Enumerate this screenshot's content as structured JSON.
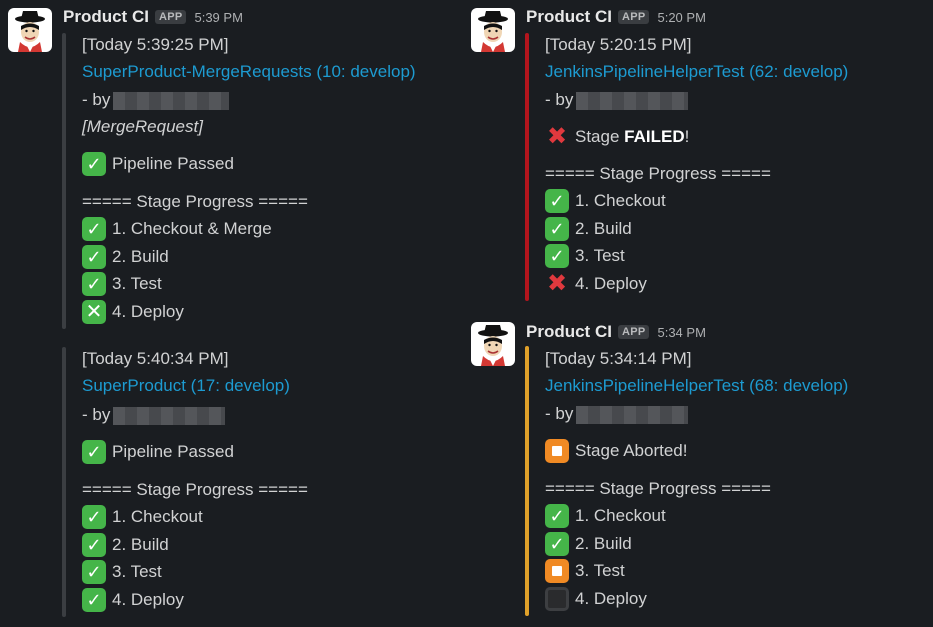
{
  "colors": {
    "background": "#1a1d21",
    "link": "#1d9bd1",
    "bar_neutral": "#3b3e42",
    "bar_failed": "#b3151d",
    "bar_aborted": "#e0a12a",
    "check_green": "#45b549"
  },
  "bot": {
    "name": "Product CI",
    "badge": "APP"
  },
  "messages": [
    {
      "time": "5:39 PM",
      "blocks": [
        {
          "timestamp": "[Today 5:39:25 PM]",
          "link": "SuperProduct-MergeRequests (10: develop)",
          "by": "- by",
          "tag": "[MergeRequest]",
          "status_icon": "check",
          "status": "Pipeline Passed",
          "progress_header": "===== Stage Progress =====",
          "stages": [
            {
              "icon": "check",
              "label": "1. Checkout & Merge"
            },
            {
              "icon": "check",
              "label": "2. Build"
            },
            {
              "icon": "check",
              "label": "3. Test"
            },
            {
              "icon": "x-green",
              "label": "4. Deploy"
            }
          ]
        },
        {
          "timestamp": "[Today 5:40:34 PM]",
          "link": "SuperProduct (17: develop)",
          "by": "- by",
          "status_icon": "check",
          "status": "Pipeline Passed",
          "progress_header": "===== Stage Progress =====",
          "stages": [
            {
              "icon": "check",
              "label": "1. Checkout"
            },
            {
              "icon": "check",
              "label": "2. Build"
            },
            {
              "icon": "check",
              "label": "3. Test"
            },
            {
              "icon": "check",
              "label": "4. Deploy"
            }
          ]
        }
      ]
    },
    {
      "time": "5:20 PM",
      "timestamp": "[Today 5:20:15 PM]",
      "link": "JenkinsPipelineHelperTest (62: develop)",
      "by": "- by",
      "status_icon": "cross",
      "status_prefix": "Stage ",
      "status_bold": "FAILED",
      "status_suffix": "!",
      "progress_header": "===== Stage Progress =====",
      "stages": [
        {
          "icon": "check",
          "label": "1. Checkout"
        },
        {
          "icon": "check",
          "label": "2. Build"
        },
        {
          "icon": "check",
          "label": "3. Test"
        },
        {
          "icon": "cross",
          "label": "4. Deploy"
        }
      ]
    },
    {
      "time": "5:34 PM",
      "timestamp": "[Today 5:34:14 PM]",
      "link": "JenkinsPipelineHelperTest (68: develop)",
      "by": "- by",
      "status_icon": "stop",
      "status": "Stage Aborted!",
      "progress_header": "===== Stage Progress =====",
      "stages": [
        {
          "icon": "check",
          "label": "1. Checkout"
        },
        {
          "icon": "check",
          "label": "2. Build"
        },
        {
          "icon": "stop",
          "label": "3. Test"
        },
        {
          "icon": "black-square",
          "label": "4. Deploy"
        }
      ]
    }
  ]
}
